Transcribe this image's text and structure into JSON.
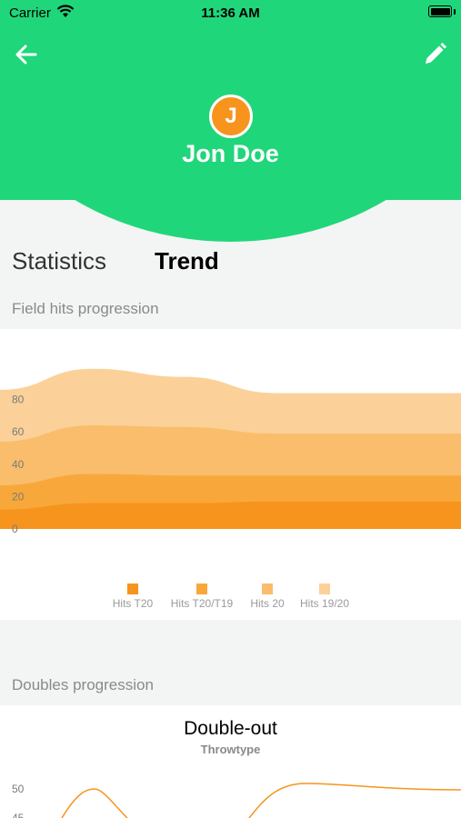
{
  "status_bar": {
    "carrier": "Carrier",
    "time": "11:36 AM"
  },
  "header": {
    "avatar_initial": "J",
    "user_name": "Jon Doe",
    "background_color": "#20d67a",
    "avatar_color": "#f7941d"
  },
  "tabs": [
    {
      "label": "Statistics",
      "selected": false
    },
    {
      "label": "Trend",
      "selected": true
    }
  ],
  "sections": {
    "field_hits_title": "Field hits progression",
    "doubles_title": "Doubles progression"
  },
  "chart_data": [
    {
      "type": "area",
      "stacked": true,
      "yticks": [
        "0",
        "20",
        "40",
        "60",
        "80"
      ],
      "ylim": [
        0,
        100
      ],
      "x": [
        0,
        1,
        2,
        3,
        4,
        5
      ],
      "series": [
        {
          "name": "Hits T20",
          "color": "#f7941d",
          "values": [
            12,
            16,
            16,
            17,
            17,
            17
          ]
        },
        {
          "name": "Hits T20/T19",
          "color": "#f8a83a",
          "values": [
            15,
            18,
            17,
            16,
            16,
            16
          ]
        },
        {
          "name": "Hits 20",
          "color": "#f9bd6b",
          "values": [
            27,
            30,
            30,
            26,
            26,
            26
          ]
        },
        {
          "name": "Hits 19/20",
          "color": "#fbd199",
          "values": [
            32,
            35,
            31,
            25,
            25,
            25
          ]
        }
      ],
      "legend_position": "bottom",
      "grid": false
    },
    {
      "type": "line",
      "title": "Double-out",
      "subtitle": "Throwtype",
      "yticks": [
        "50",
        "45"
      ],
      "series_color": "#f7941d",
      "grid": false
    }
  ]
}
